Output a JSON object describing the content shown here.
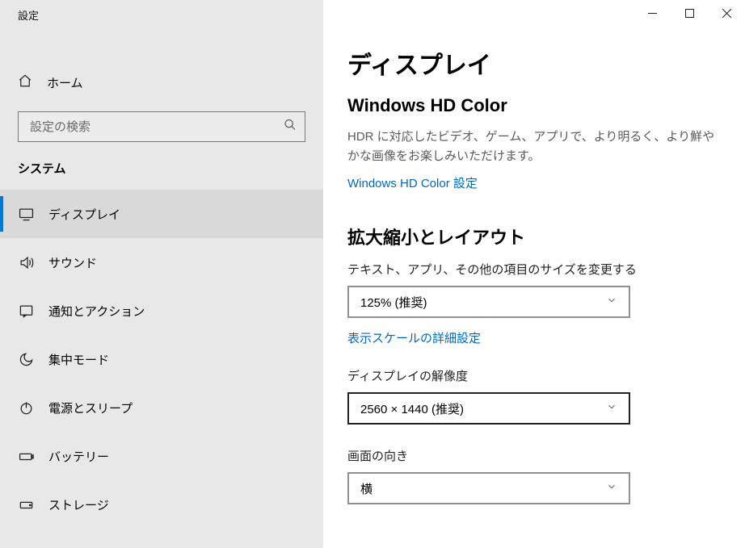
{
  "window": {
    "title": "設定"
  },
  "sidebar": {
    "home": "ホーム",
    "search_placeholder": "設定の検索",
    "category": "システム",
    "items": [
      {
        "label": "ディスプレイ"
      },
      {
        "label": "サウンド"
      },
      {
        "label": "通知とアクション"
      },
      {
        "label": "集中モード"
      },
      {
        "label": "電源とスリープ"
      },
      {
        "label": "バッテリー"
      },
      {
        "label": "ストレージ"
      }
    ]
  },
  "page": {
    "heading": "ディスプレイ",
    "hd_color": {
      "title": "Windows HD Color",
      "desc": "HDR に対応したビデオ、ゲーム、アプリで、より明るく、より鮮やかな画像をお楽しみいただけます。",
      "link": "Windows HD Color 設定"
    },
    "scale": {
      "title": "拡大縮小とレイアウト",
      "size_label": "テキスト、アプリ、その他の項目のサイズを変更する",
      "size_value": "125% (推奨)",
      "advanced_link": "表示スケールの詳細設定",
      "resolution_label": "ディスプレイの解像度",
      "resolution_value": "2560 × 1440 (推奨)",
      "orientation_label": "画面の向き",
      "orientation_value": "横"
    }
  }
}
